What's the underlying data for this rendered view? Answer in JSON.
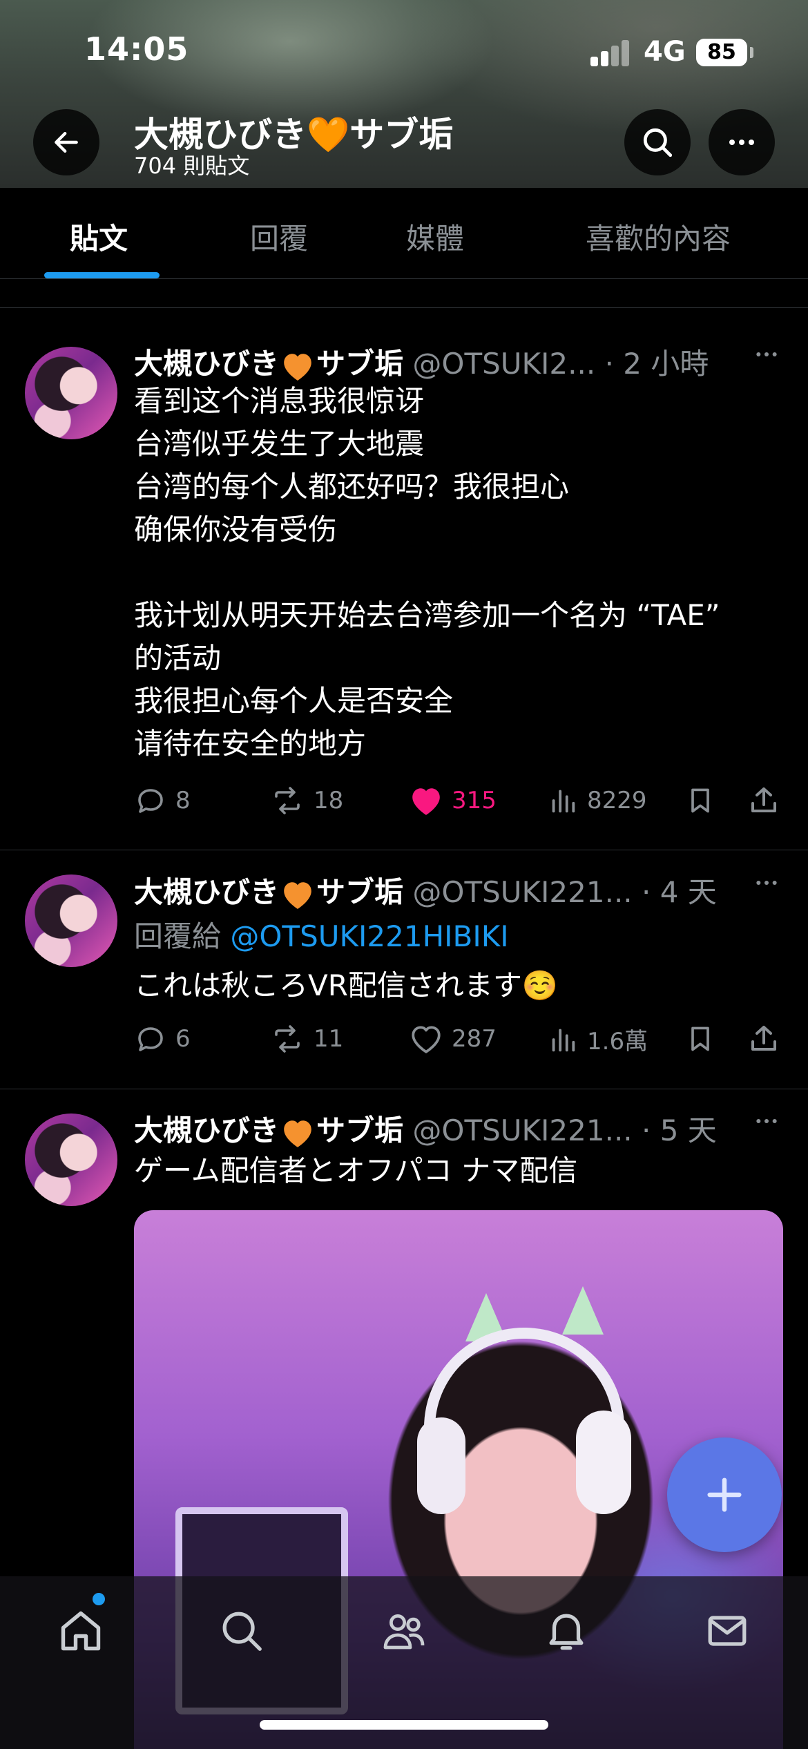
{
  "status_bar": {
    "time": "14:05",
    "network": "4G",
    "battery": "85"
  },
  "header": {
    "name": "大槻ひびき🧡サブ垢",
    "post_count": "704 則貼文"
  },
  "tabs": [
    {
      "label": "貼文",
      "active": true
    },
    {
      "label": "回覆",
      "active": false
    },
    {
      "label": "媒體",
      "active": false
    },
    {
      "label": "喜歡的內容",
      "active": false
    }
  ],
  "posts": [
    {
      "name": "大槻ひびき",
      "name_suffix": "サブ垢",
      "handle": "@OTSUKI2...",
      "time": "· 2 小時",
      "text_lines": [
        "看到这个消息我很惊讶",
        "台湾似乎发生了大地震",
        "台湾的每个人都还好吗？我很担心",
        "确保你没有受伤",
        "",
        "我计划从明天开始去台湾参加一个名为 “TAE”",
        "的活动",
        "我很担心每个人是否安全",
        "请待在安全的地方"
      ],
      "replies": "8",
      "reposts": "18",
      "likes": "315",
      "views": "8229",
      "liked": true
    },
    {
      "name": "大槻ひびき",
      "name_suffix": "サブ垢",
      "handle": "@OTSUKI221...",
      "time": "· 4 天",
      "reply_prefix": "回覆給",
      "reply_to": "@OTSUKI221HIBIKI",
      "text_lines": [
        "これは秋ころVR配信されます☺️"
      ],
      "replies": "6",
      "reposts": "11",
      "likes": "287",
      "views": "1.6萬",
      "liked": false
    },
    {
      "name": "大槻ひびき",
      "name_suffix": "サブ垢",
      "handle": "@OTSUKI221...",
      "time": "· 5 天",
      "text_lines": [
        "ゲーム配信者とオフパコ ナマ配信"
      ]
    }
  ],
  "colors": {
    "accent": "#1d9bf0",
    "like": "#f91880",
    "muted": "#8b9095",
    "fab": "#5b77e6",
    "heart_emoji": "#f5922f"
  },
  "icons": {
    "nav": [
      "home-icon",
      "search-icon",
      "communities-icon",
      "notifications-icon",
      "messages-icon"
    ],
    "fab": "plus-icon"
  }
}
